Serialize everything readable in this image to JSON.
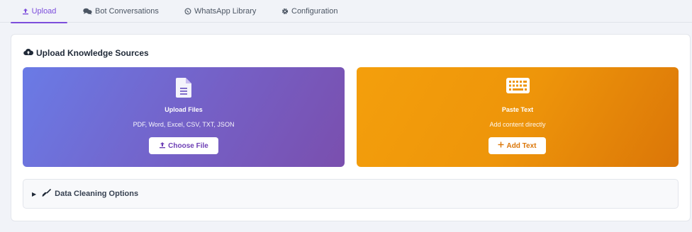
{
  "tabs": [
    {
      "label": "Upload",
      "icon": "upload-icon",
      "active": true
    },
    {
      "label": "Bot Conversations",
      "icon": "comments-icon",
      "active": false
    },
    {
      "label": "WhatsApp Library",
      "icon": "whatsapp-icon",
      "active": false
    },
    {
      "label": "Configuration",
      "icon": "gear-icon",
      "active": false
    }
  ],
  "card": {
    "title": "Upload Knowledge Sources",
    "title_icon": "cloud-upload-icon"
  },
  "files_tile": {
    "icon": "file-icon",
    "title": "Upload Files",
    "subtitle": "PDF, Word, Excel, CSV, TXT, JSON",
    "button_label": "Choose File",
    "button_icon": "upload-icon"
  },
  "text_tile": {
    "icon": "keyboard-icon",
    "title": "Paste Text",
    "subtitle": "Add content directly",
    "button_label": "Add Text",
    "button_icon": "plus-icon"
  },
  "accordion": {
    "label": "Data Cleaning Options",
    "icon": "broom-icon"
  },
  "colors": {
    "accent": "#7c4ddb",
    "files_gradient_start": "#6a7be6",
    "files_gradient_end": "#7a4fae",
    "text_gradient_start": "#f49f0c",
    "text_gradient_end": "#db7608"
  }
}
